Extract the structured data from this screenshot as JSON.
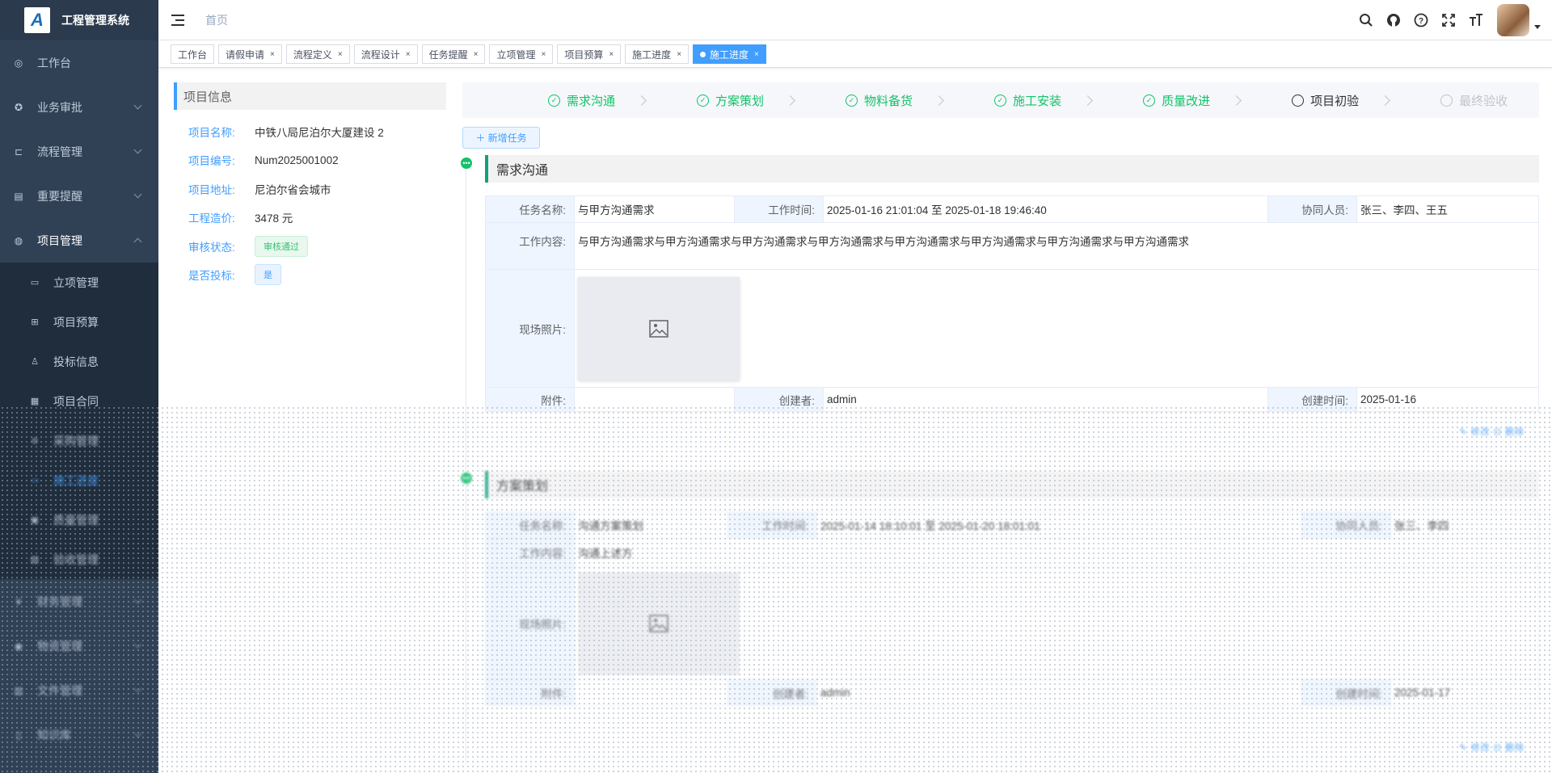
{
  "app": {
    "title": "工程管理系统",
    "logo_letter": "A"
  },
  "sidebar": {
    "items": [
      {
        "label": "工作台",
        "icon": "dashboard-icon"
      },
      {
        "label": "业务审批",
        "icon": "approval-icon"
      },
      {
        "label": "流程管理",
        "icon": "flow-icon"
      },
      {
        "label": "重要提醒",
        "icon": "reminder-icon"
      },
      {
        "label": "项目管理",
        "icon": "globe-icon"
      }
    ],
    "sub_items": [
      {
        "label": "立项管理",
        "icon": "monitor-icon"
      },
      {
        "label": "项目预算",
        "icon": "table-icon"
      },
      {
        "label": "投标信息",
        "icon": "tender-icon"
      },
      {
        "label": "项目合同",
        "icon": "contract-icon"
      },
      {
        "label": "采购管理",
        "icon": "purchase-icon"
      },
      {
        "label": "施工进度",
        "icon": "progress-icon"
      },
      {
        "label": "质量管理",
        "icon": "quality-icon"
      },
      {
        "label": "验收管理",
        "icon": "acceptance-icon"
      }
    ],
    "bottom_items": [
      {
        "label": "财务管理",
        "icon": "yen-icon"
      },
      {
        "label": "物资管理",
        "icon": "materials-icon"
      },
      {
        "label": "文件管理",
        "icon": "file-icon"
      },
      {
        "label": "知识库",
        "icon": "book-icon"
      }
    ]
  },
  "header": {
    "breadcrumb": "首页",
    "icons": [
      "search-icon",
      "github-icon",
      "help-icon",
      "fullscreen-icon",
      "font-size-icon"
    ]
  },
  "tags": [
    {
      "label": "工作台",
      "closable": false
    },
    {
      "label": "请假申请",
      "closable": true
    },
    {
      "label": "流程定义",
      "closable": true
    },
    {
      "label": "流程设计",
      "closable": true
    },
    {
      "label": "任务提醒",
      "closable": true
    },
    {
      "label": "立项管理",
      "closable": true
    },
    {
      "label": "项目预算",
      "closable": true
    },
    {
      "label": "施工进度",
      "closable": true
    },
    {
      "label": "施工进度",
      "closable": true,
      "active": true
    }
  ],
  "tag_close": "×",
  "project_info": {
    "title": "项目信息",
    "rows": [
      {
        "label": "项目名称:",
        "value": "中铁八局尼泊尔大厦建设 2"
      },
      {
        "label": "项目编号:",
        "value": "Num2025001002"
      },
      {
        "label": "项目地址:",
        "value": "尼泊尔省会城市"
      },
      {
        "label": "工程造价:",
        "value": "3478 元"
      }
    ],
    "status_label": "审核状态:",
    "status_value": "审核通过",
    "bid_label": "是否投标:",
    "bid_value": "是"
  },
  "steps": [
    {
      "label": "需求沟通",
      "state": "done"
    },
    {
      "label": "方案策划",
      "state": "done"
    },
    {
      "label": "物料备货",
      "state": "done"
    },
    {
      "label": "施工安装",
      "state": "done"
    },
    {
      "label": "质量改进",
      "state": "done"
    },
    {
      "label": "项目初验",
      "state": "current"
    },
    {
      "label": "最终验收",
      "state": "wait"
    }
  ],
  "add_task_button": "＋ 新增任务",
  "tasks": [
    {
      "title": "需求沟通",
      "name_label": "任务名称:",
      "name": "与甲方沟通需求",
      "time_label": "工作时间:",
      "time": "2025-01-16 21:01:04 至 2025-01-18 19:46:40",
      "people_label": "协同人员:",
      "people": "张三、李四、王五",
      "content_label": "工作内容:",
      "content": "与甲方沟通需求与甲方沟通需求与甲方沟通需求与甲方沟通需求与甲方沟通需求与甲方沟通需求与甲方沟通需求与甲方沟通需求",
      "photo_label": "现场照片:",
      "attach_label": "附件:",
      "attach": "",
      "creator_label": "创建者:",
      "creator": "admin",
      "created_label": "创建时间:",
      "created": "2025-01-16",
      "pager": "✎ 修改   ⊡ 删除"
    },
    {
      "title": "方案策划",
      "name_label": "任务名称:",
      "name": "沟通方案策划",
      "time_label": "工作时间:",
      "time": "2025-01-14 18:10:01 至 2025-01-20 18:01:01",
      "people_label": "协同人员:",
      "people": "张三、李四",
      "content_label": "工作内容:",
      "content": "沟通上述方",
      "photo_label": "现场照片:",
      "attach_label": "附件:",
      "attach": "",
      "creator_label": "创建者:",
      "creator": "admin",
      "created_label": "创建时间:",
      "created": "2025-01-17",
      "pager": "✎ 修改   ⊡ 删除"
    }
  ]
}
